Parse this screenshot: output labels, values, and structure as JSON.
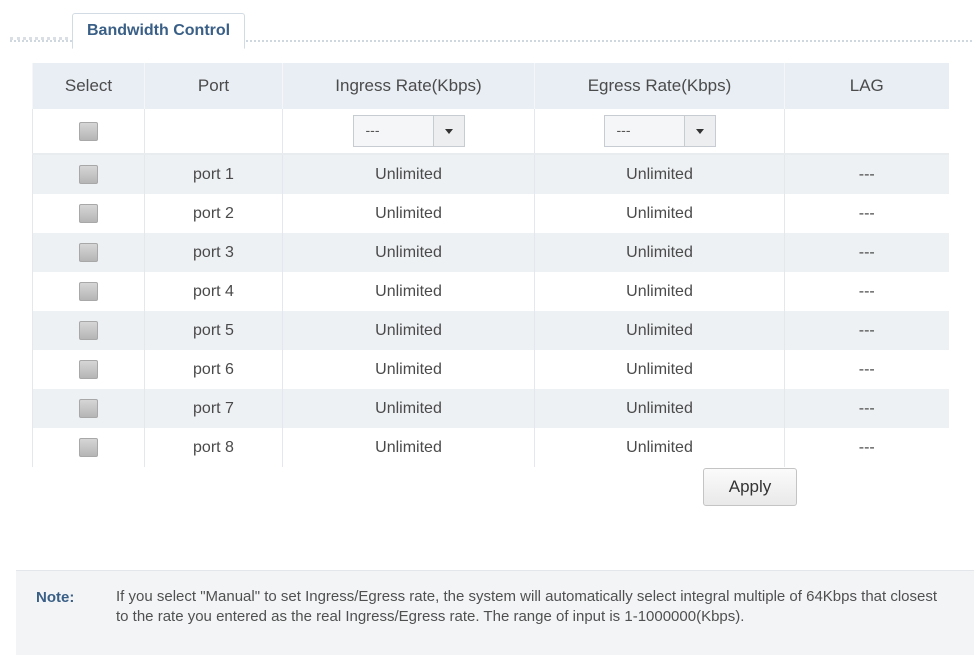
{
  "tab": {
    "label": "Bandwidth Control"
  },
  "table": {
    "columns": [
      "Select",
      "Port",
      "Ingress Rate(Kbps)",
      "Egress Rate(Kbps)",
      "LAG"
    ],
    "filter": {
      "ingress_value": "---",
      "egress_value": "---"
    },
    "rows": [
      {
        "port": "port 1",
        "ingress": "Unlimited",
        "egress": "Unlimited",
        "lag": "---"
      },
      {
        "port": "port 2",
        "ingress": "Unlimited",
        "egress": "Unlimited",
        "lag": "---"
      },
      {
        "port": "port 3",
        "ingress": "Unlimited",
        "egress": "Unlimited",
        "lag": "---"
      },
      {
        "port": "port 4",
        "ingress": "Unlimited",
        "egress": "Unlimited",
        "lag": "---"
      },
      {
        "port": "port 5",
        "ingress": "Unlimited",
        "egress": "Unlimited",
        "lag": "---"
      },
      {
        "port": "port 6",
        "ingress": "Unlimited",
        "egress": "Unlimited",
        "lag": "---"
      },
      {
        "port": "port 7",
        "ingress": "Unlimited",
        "egress": "Unlimited",
        "lag": "---"
      },
      {
        "port": "port 8",
        "ingress": "Unlimited",
        "egress": "Unlimited",
        "lag": "---"
      }
    ]
  },
  "apply_label": "Apply",
  "note": {
    "label": "Note:",
    "text": "If you select \"Manual\" to set Ingress/Egress rate, the system will automatically select integral multiple of 64Kbps that closest to the rate you entered as the real Ingress/Egress rate. The range of input is 1-1000000(Kbps)."
  },
  "colors": {
    "accent": "#3a5f86",
    "header_bg": "#e8eef4",
    "stripe": "#eef1f4"
  }
}
